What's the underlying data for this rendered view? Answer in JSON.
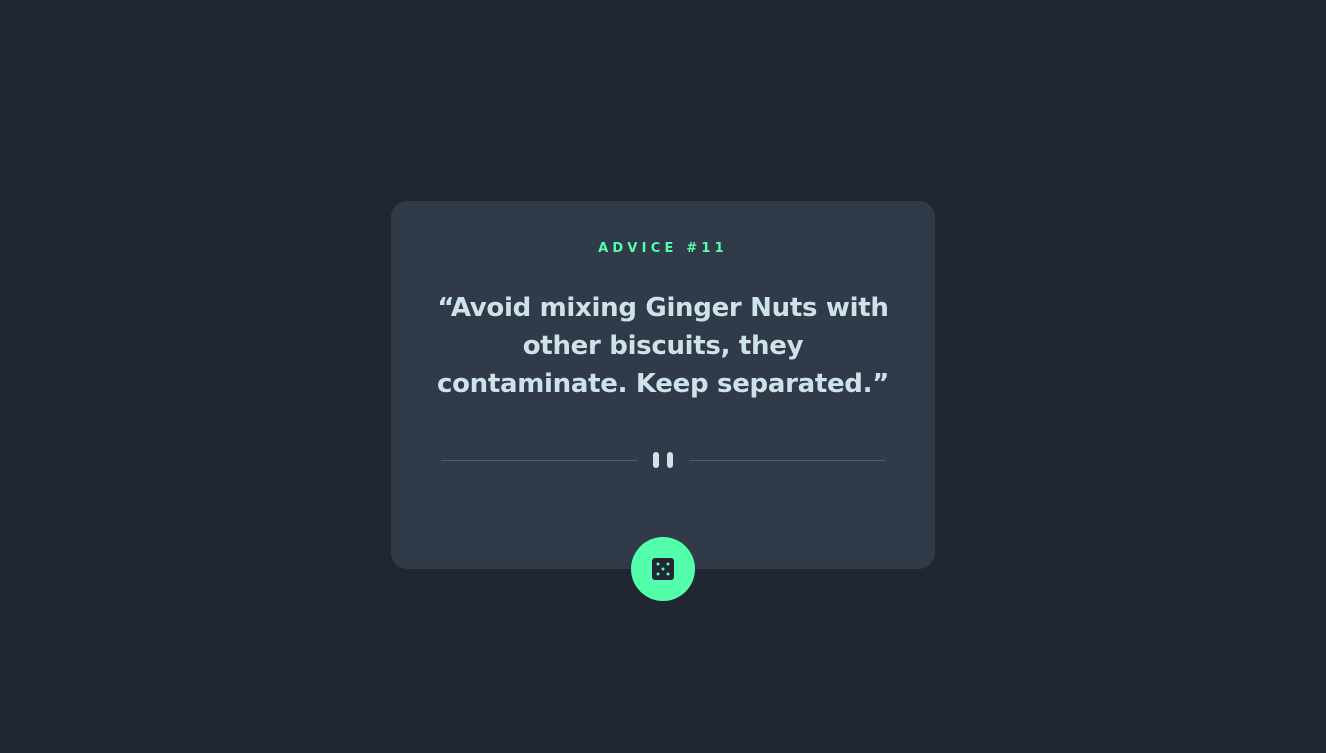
{
  "advice": {
    "label": "ADVICE #11",
    "text": "“Avoid mixing Ginger Nuts with other biscuits, they contaminate. Keep separated.”"
  },
  "icons": {
    "divider": "pause-icon",
    "button": "dice-icon"
  },
  "colors": {
    "background": "#202632",
    "card": "#313a48",
    "accent": "#53ffaa",
    "text": "#cee3e9",
    "divider": "#4f5d74"
  }
}
